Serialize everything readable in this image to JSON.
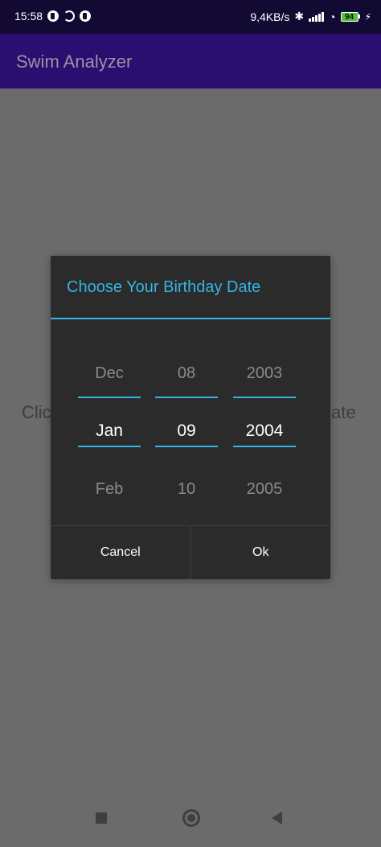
{
  "status_bar": {
    "time": "15:58",
    "network_speed": "9,4KB/s",
    "battery": "94",
    "icons": [
      "facebook-icon",
      "sync-icon",
      "facebook-icon",
      "bluetooth-icon",
      "signal-icon",
      "wifi-icon",
      "battery-icon",
      "charging-icon"
    ]
  },
  "app_bar": {
    "title": "Swim Analyzer"
  },
  "background": {
    "left_text": "Clic",
    "right_text": "ate"
  },
  "dialog": {
    "title": "Choose Your Birthday Date",
    "month": {
      "prev": "Dec",
      "selected": "Jan",
      "next": "Feb"
    },
    "day": {
      "prev": "08",
      "selected": "09",
      "next": "10"
    },
    "year": {
      "prev": "2003",
      "selected": "2004",
      "next": "2005"
    },
    "cancel_label": "Cancel",
    "ok_label": "Ok",
    "accent_color": "#33b5e5"
  },
  "nav_bar": {
    "icons": [
      "recents-icon",
      "home-icon",
      "back-icon"
    ]
  }
}
